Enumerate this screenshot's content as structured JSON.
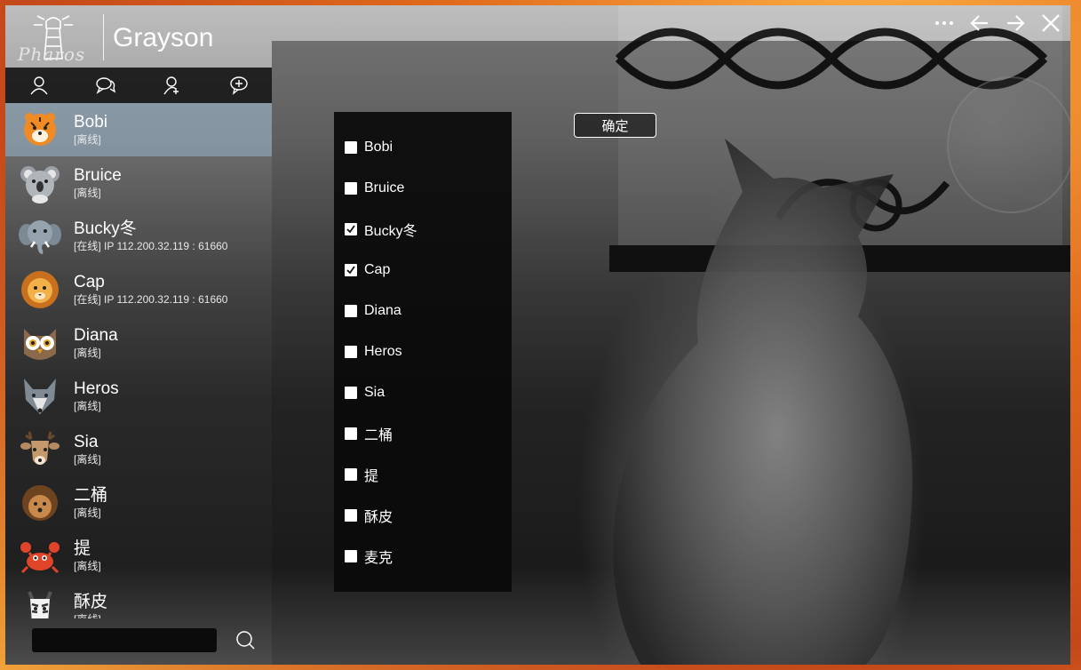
{
  "app": {
    "logo_text": "Pharos",
    "title": "Grayson"
  },
  "window_controls": [
    {
      "name": "more-button",
      "icon": "more-icon"
    },
    {
      "name": "back-button",
      "icon": "arrow-left-icon"
    },
    {
      "name": "forward-button",
      "icon": "arrow-right-icon"
    },
    {
      "name": "close-button",
      "icon": "close-icon"
    }
  ],
  "tabs": [
    {
      "icon": "user-icon"
    },
    {
      "icon": "chat-icon"
    },
    {
      "icon": "contacts-icon"
    },
    {
      "icon": "group-chat-icon"
    }
  ],
  "contacts": [
    {
      "name": "Bobi",
      "status": "[离线]",
      "avatar": "tiger",
      "selected": true
    },
    {
      "name": "Bruice",
      "status": "[离线]",
      "avatar": "koala"
    },
    {
      "name": "Bucky冬",
      "status": "[在线] IP 112.200.32.119 : 61660",
      "avatar": "elephant"
    },
    {
      "name": "Cap",
      "status": "[在线] IP 112.200.32.119 : 61660",
      "avatar": "lion"
    },
    {
      "name": "Diana",
      "status": "[离线]",
      "avatar": "owl"
    },
    {
      "name": "Heros",
      "status": "[离线]",
      "avatar": "wolf"
    },
    {
      "name": "Sia",
      "status": "[离线]",
      "avatar": "deer"
    },
    {
      "name": "二桶",
      "status": "[离线]",
      "avatar": "hedgehog"
    },
    {
      "name": "提",
      "status": "[离线]",
      "avatar": "crab"
    },
    {
      "name": "酥皮",
      "status": "[离线]",
      "avatar": "zebra"
    }
  ],
  "search": {
    "placeholder": ""
  },
  "select_list": [
    {
      "label": "Bobi",
      "checked": false
    },
    {
      "label": "Bruice",
      "checked": false
    },
    {
      "label": "Bucky冬",
      "checked": true
    },
    {
      "label": "Cap",
      "checked": true
    },
    {
      "label": "Diana",
      "checked": false
    },
    {
      "label": "Heros",
      "checked": false
    },
    {
      "label": "Sia",
      "checked": false
    },
    {
      "label": "二桶",
      "checked": false
    },
    {
      "label": "提",
      "checked": false
    },
    {
      "label": "酥皮",
      "checked": false
    },
    {
      "label": "麦克",
      "checked": false
    }
  ],
  "confirm_label": "确定",
  "colors": {
    "accent_selected": "#a0c3e1",
    "panel_dark": "#0a0a0a"
  }
}
